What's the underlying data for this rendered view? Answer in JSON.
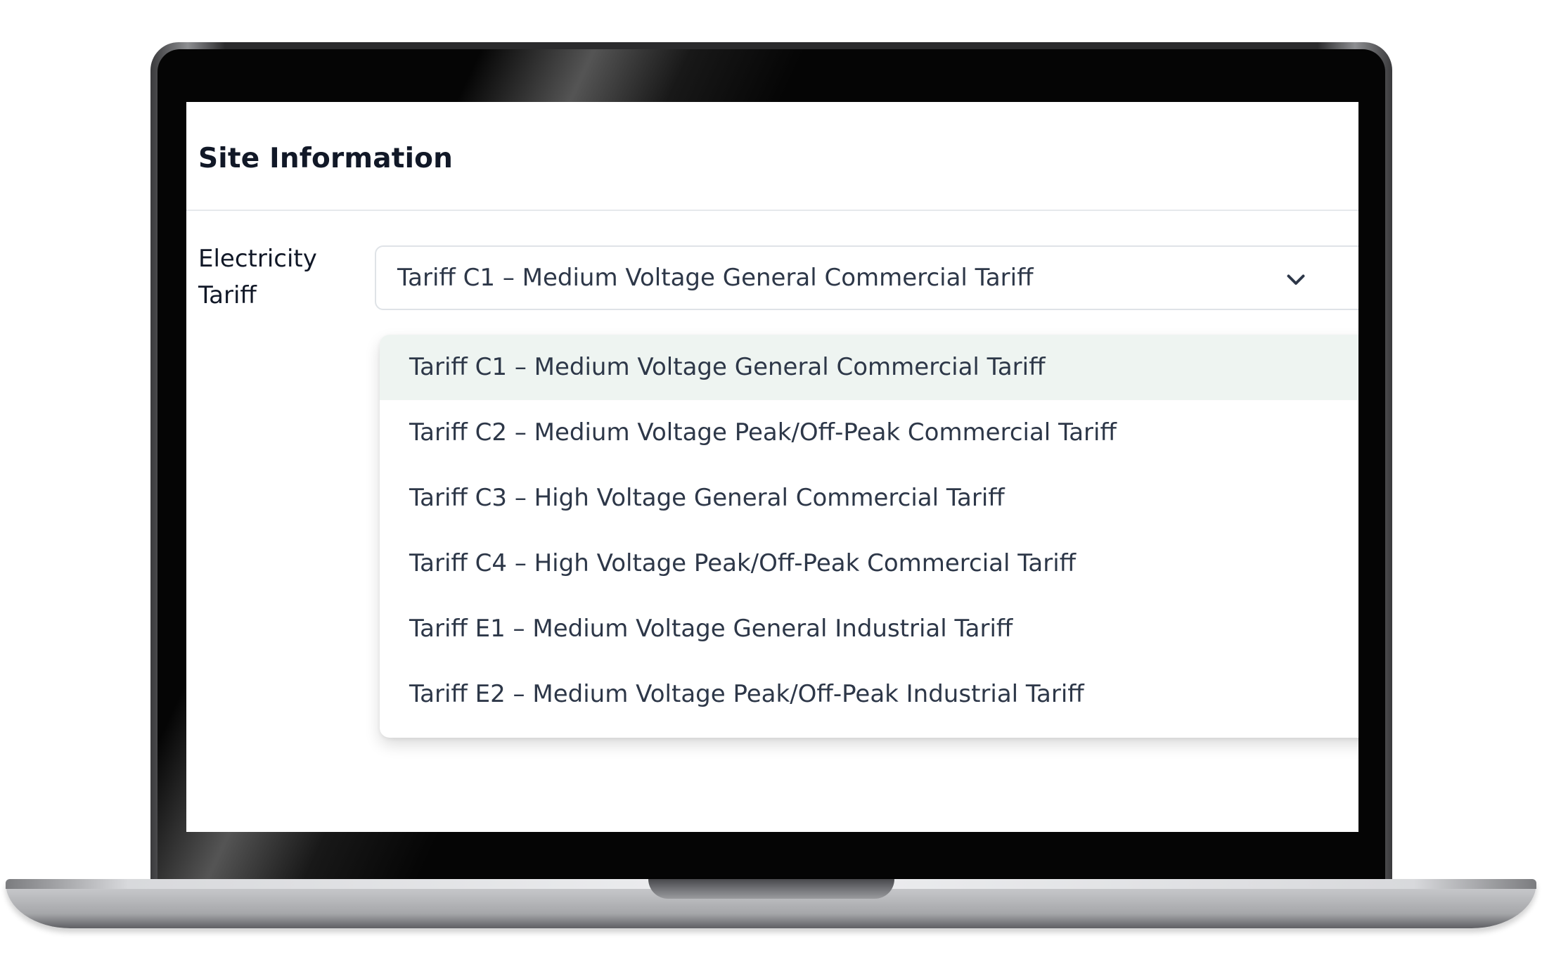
{
  "page": {
    "title": "Site Information"
  },
  "form": {
    "tariff_label": "Electricity Tariff",
    "tariff_select": {
      "selected_value": "Tariff C1 – Medium Voltage General Commercial Tariff",
      "icon": "chevron-down-icon",
      "expanded": true
    },
    "tariff_options": [
      "Tariff C1 – Medium Voltage General Commercial Tariff",
      "Tariff C2 – Medium Voltage Peak/Off-Peak Commercial Tariff",
      "Tariff C3 – High Voltage General Commercial Tariff",
      "Tariff C4 – High Voltage Peak/Off-Peak Commercial Tariff",
      "Tariff E1 – Medium Voltage General Industrial Tariff",
      "Tariff E2 – Medium Voltage Peak/Off-Peak Industrial Tariff"
    ],
    "highlighted_option_index": 0
  },
  "colors": {
    "text_primary": "#111827",
    "text_secondary": "#2d3748",
    "option_highlight": "#eef4f1",
    "border": "#dfe3e7"
  }
}
